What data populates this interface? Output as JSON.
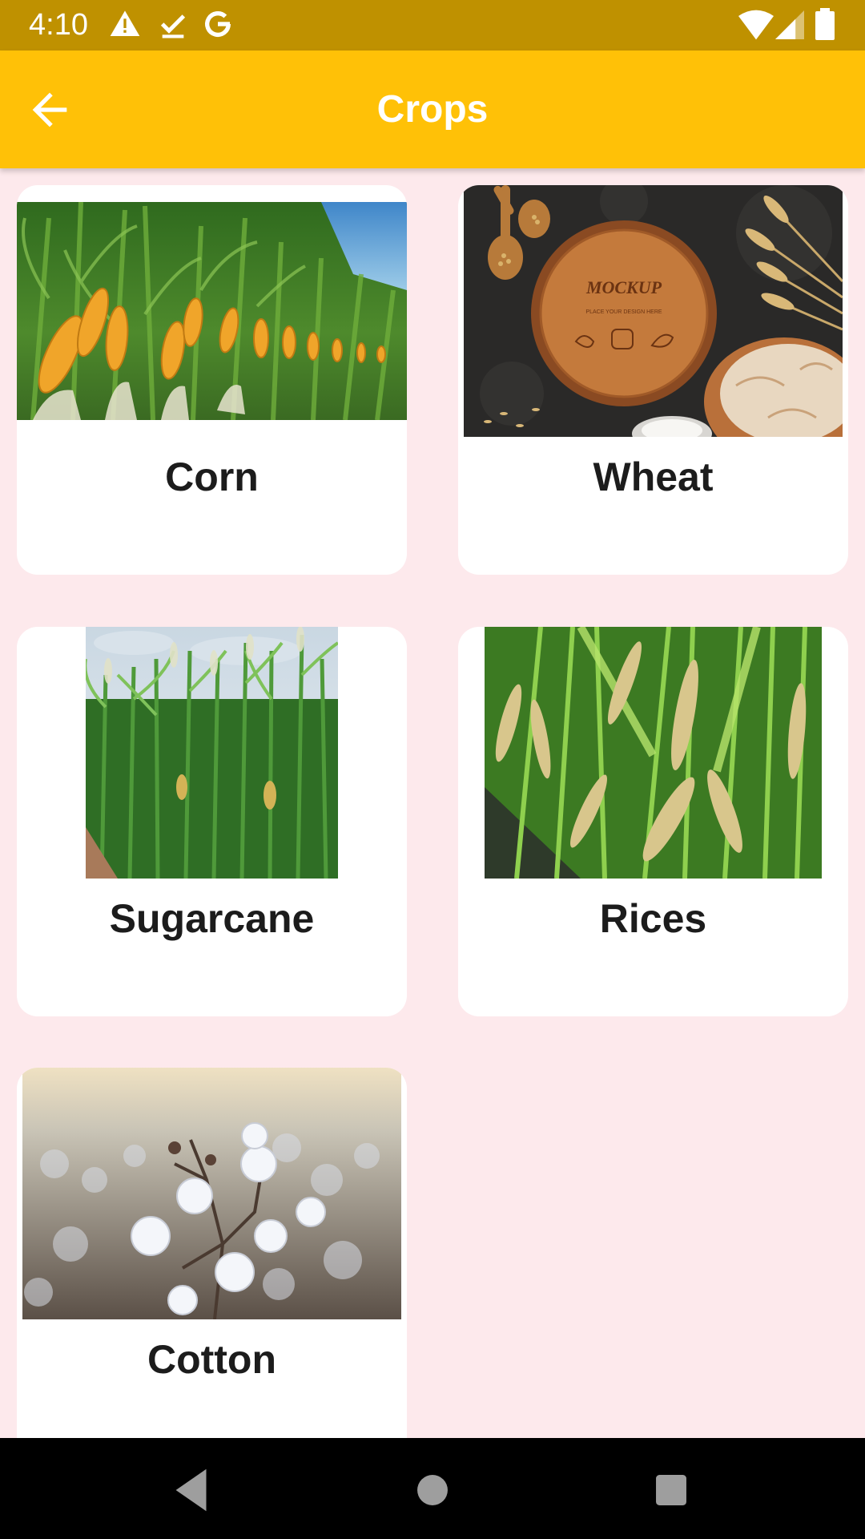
{
  "status_bar": {
    "time": "4:10",
    "icons": [
      "warning-icon",
      "download-done-icon",
      "google-g-icon",
      "wifi-icon",
      "signal-icon",
      "battery-icon"
    ]
  },
  "app_bar": {
    "title": "Crops",
    "back_icon": "arrow-back-icon"
  },
  "crops": [
    {
      "label": "Corn"
    },
    {
      "label": "Wheat"
    },
    {
      "label": "Sugarcane"
    },
    {
      "label": "Rices"
    },
    {
      "label": "Cotton"
    }
  ],
  "wheat_image_text": {
    "headline": "MOCKUP",
    "subtext": "PLACE YOUR DESIGN HERE"
  },
  "nav_bar": {
    "icons": [
      "back-triangle-icon",
      "home-circle-icon",
      "recents-square-icon"
    ]
  },
  "colors": {
    "status_bar": "#bf9100",
    "app_bar": "#ffc107",
    "background": "#fde9ec",
    "card": "#ffffff",
    "label": "#1c1c1c"
  }
}
